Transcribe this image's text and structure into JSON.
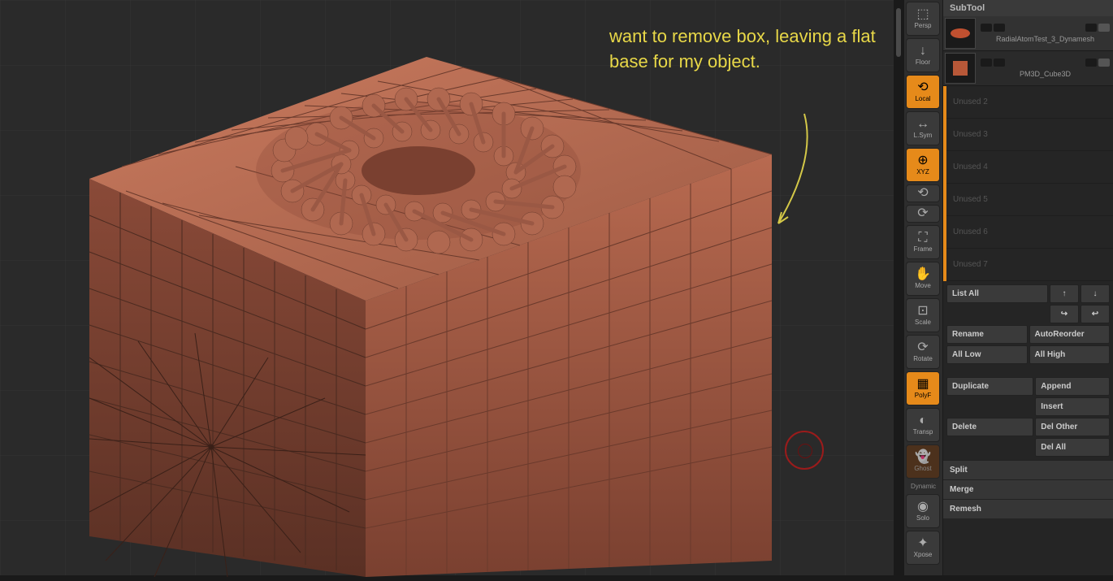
{
  "annotation": "want to remove box, leaving a flat base for my object.",
  "panel": {
    "header": "SubTool"
  },
  "subtools": [
    {
      "name": "RadialAtomTest_3_Dynamesh"
    },
    {
      "name": "PM3D_Cube3D"
    }
  ],
  "slots": [
    "Unused 2",
    "Unused 3",
    "Unused 4",
    "Unused 5",
    "Unused 6",
    "Unused 7"
  ],
  "toolbar": {
    "persp": "Persp",
    "floor": "Floor",
    "local": "Local",
    "lsym": "L.Sym",
    "xyz": "XYZ",
    "frame": "Frame",
    "move": "Move",
    "scale": "Scale",
    "rotate": "Rotate",
    "polyf": "PolyF",
    "transp": "Transp",
    "ghost": "Ghost",
    "dynamic": "Dynamic",
    "solo": "Solo",
    "xpose": "Xpose"
  },
  "buttons": {
    "list_all": "List All",
    "rename": "Rename",
    "autoreorder": "AutoReorder",
    "all_low": "All Low",
    "all_high": "All High",
    "duplicate": "Duplicate",
    "append": "Append",
    "insert": "Insert",
    "delete": "Delete",
    "del_other": "Del Other",
    "del_all": "Del All",
    "split": "Split",
    "merge": "Merge",
    "remesh": "Remesh",
    "up": "↑",
    "down": "↓",
    "indent_r": "↪",
    "indent_l": "↩"
  }
}
